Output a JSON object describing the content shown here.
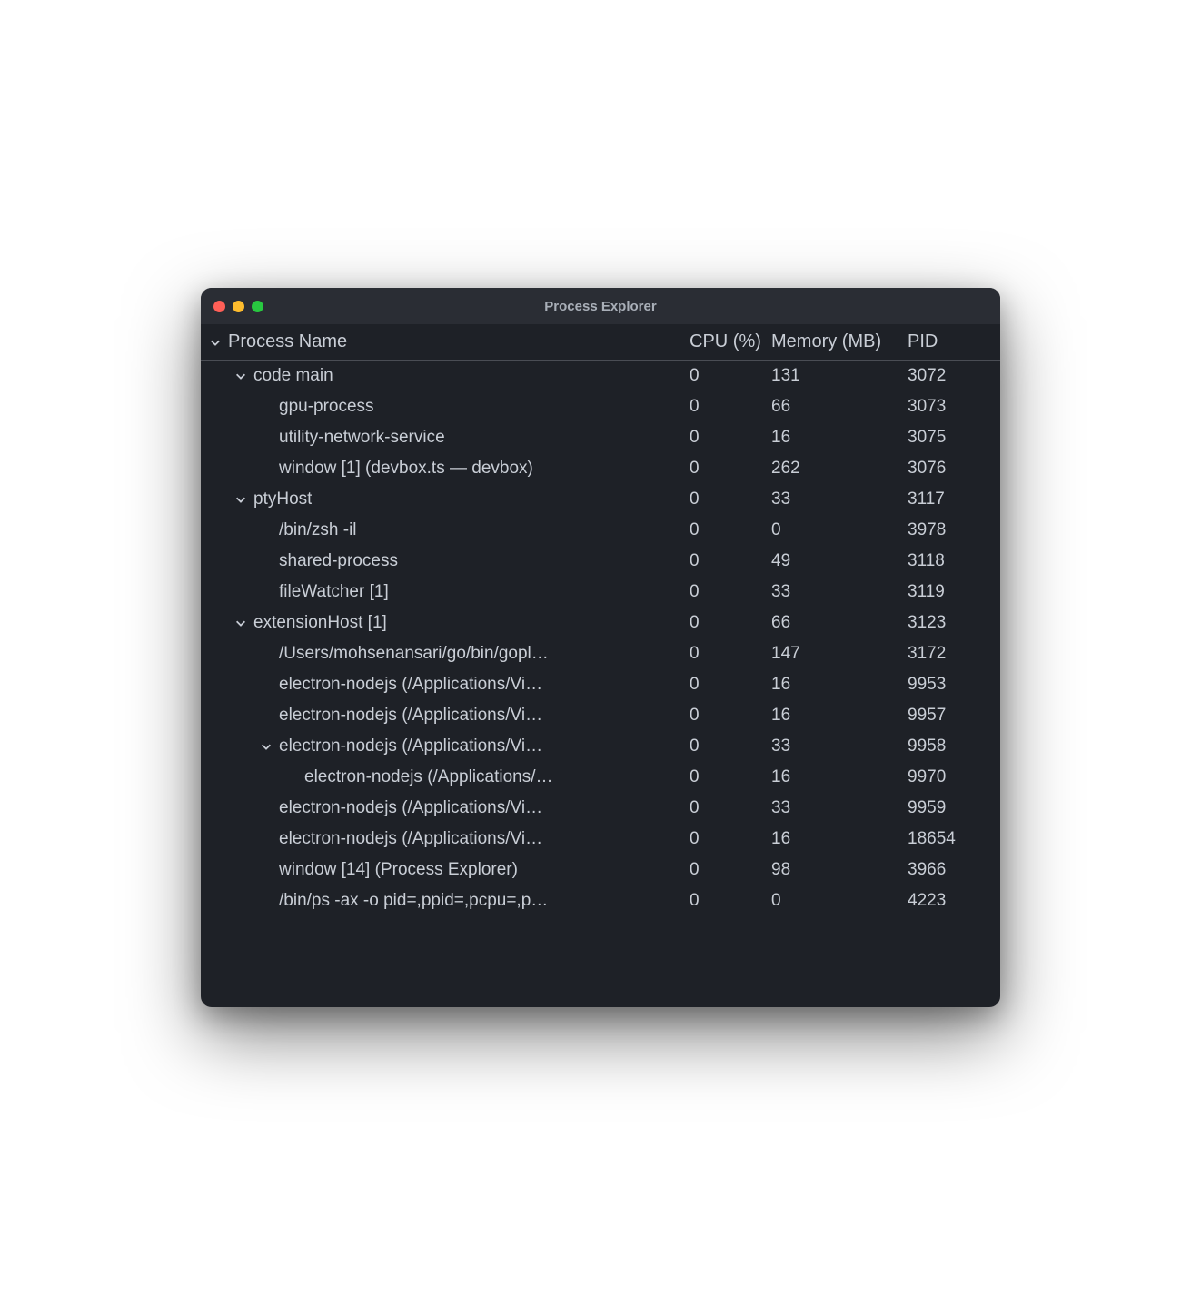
{
  "window": {
    "title": "Process Explorer"
  },
  "columns": {
    "name": "Process Name",
    "cpu": "CPU (%)",
    "memory": "Memory (MB)",
    "pid": "PID"
  },
  "rows": [
    {
      "indent": 1,
      "expandable": true,
      "name": "code main",
      "cpu": "0",
      "memory": "131",
      "pid": "3072"
    },
    {
      "indent": 2,
      "expandable": false,
      "name": "gpu-process",
      "cpu": "0",
      "memory": "66",
      "pid": "3073"
    },
    {
      "indent": 2,
      "expandable": false,
      "name": "utility-network-service",
      "cpu": "0",
      "memory": "16",
      "pid": "3075"
    },
    {
      "indent": 2,
      "expandable": false,
      "name": "window [1] (devbox.ts — devbox)",
      "cpu": "0",
      "memory": "262",
      "pid": "3076"
    },
    {
      "indent": 1,
      "expandable": true,
      "name": "ptyHost",
      "cpu": "0",
      "memory": "33",
      "pid": "3117"
    },
    {
      "indent": 2,
      "expandable": false,
      "name": "/bin/zsh -il",
      "cpu": "0",
      "memory": "0",
      "pid": "3978"
    },
    {
      "indent": 2,
      "expandable": false,
      "name": "shared-process",
      "cpu": "0",
      "memory": "49",
      "pid": "3118"
    },
    {
      "indent": 2,
      "expandable": false,
      "name": "fileWatcher [1]",
      "cpu": "0",
      "memory": "33",
      "pid": "3119"
    },
    {
      "indent": 1,
      "expandable": true,
      "name": "extensionHost [1]",
      "cpu": "0",
      "memory": "66",
      "pid": "3123"
    },
    {
      "indent": 2,
      "expandable": false,
      "name": "/Users/mohsenansari/go/bin/gopl…",
      "cpu": "0",
      "memory": "147",
      "pid": "3172"
    },
    {
      "indent": 2,
      "expandable": false,
      "name": "electron-nodejs (/Applications/Vi…",
      "cpu": "0",
      "memory": "16",
      "pid": "9953"
    },
    {
      "indent": 2,
      "expandable": false,
      "name": "electron-nodejs (/Applications/Vi…",
      "cpu": "0",
      "memory": "16",
      "pid": "9957"
    },
    {
      "indent": 2,
      "expandable": true,
      "name": "electron-nodejs (/Applications/Vi…",
      "cpu": "0",
      "memory": "33",
      "pid": "9958"
    },
    {
      "indent": 3,
      "expandable": false,
      "name": "electron-nodejs (/Applications/…",
      "cpu": "0",
      "memory": "16",
      "pid": "9970"
    },
    {
      "indent": 2,
      "expandable": false,
      "name": "electron-nodejs (/Applications/Vi…",
      "cpu": "0",
      "memory": "33",
      "pid": "9959"
    },
    {
      "indent": 2,
      "expandable": false,
      "name": "electron-nodejs (/Applications/Vi…",
      "cpu": "0",
      "memory": "16",
      "pid": "18654"
    },
    {
      "indent": 2,
      "expandable": false,
      "name": "window [14] (Process Explorer)",
      "cpu": "0",
      "memory": "98",
      "pid": "3966"
    },
    {
      "indent": 2,
      "expandable": false,
      "name": "/bin/ps -ax -o pid=,ppid=,pcpu=,p…",
      "cpu": "0",
      "memory": "0",
      "pid": "4223"
    }
  ]
}
